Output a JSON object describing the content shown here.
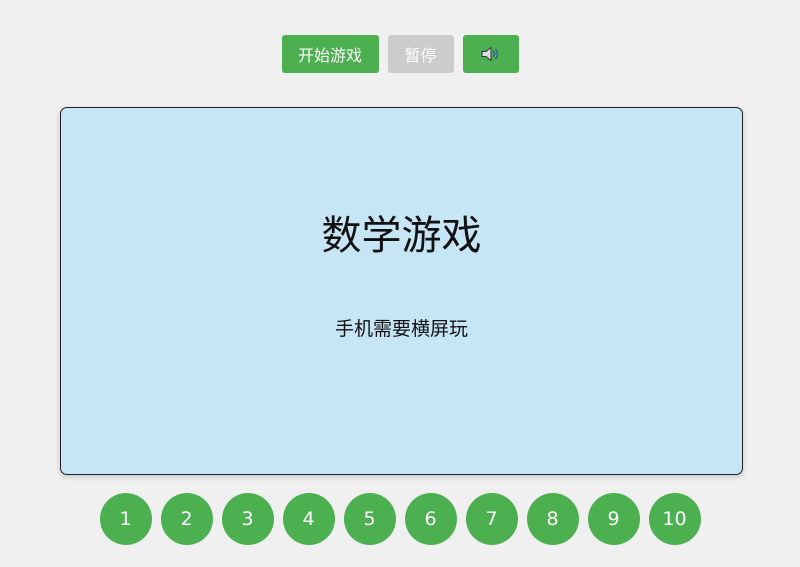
{
  "colors": {
    "page_background": "#f0f0f0",
    "accent_green": "#4caf50",
    "disabled_gray": "#cccccc",
    "board_background": "#c6e6f6"
  },
  "toolbar": {
    "start_label": "开始游戏",
    "pause_label": "暂停",
    "sound_icon": "speaker-icon"
  },
  "board": {
    "title": "数学游戏",
    "hint": "手机需要横屏玩"
  },
  "levels": [
    "1",
    "2",
    "3",
    "4",
    "5",
    "6",
    "7",
    "8",
    "9",
    "10"
  ]
}
